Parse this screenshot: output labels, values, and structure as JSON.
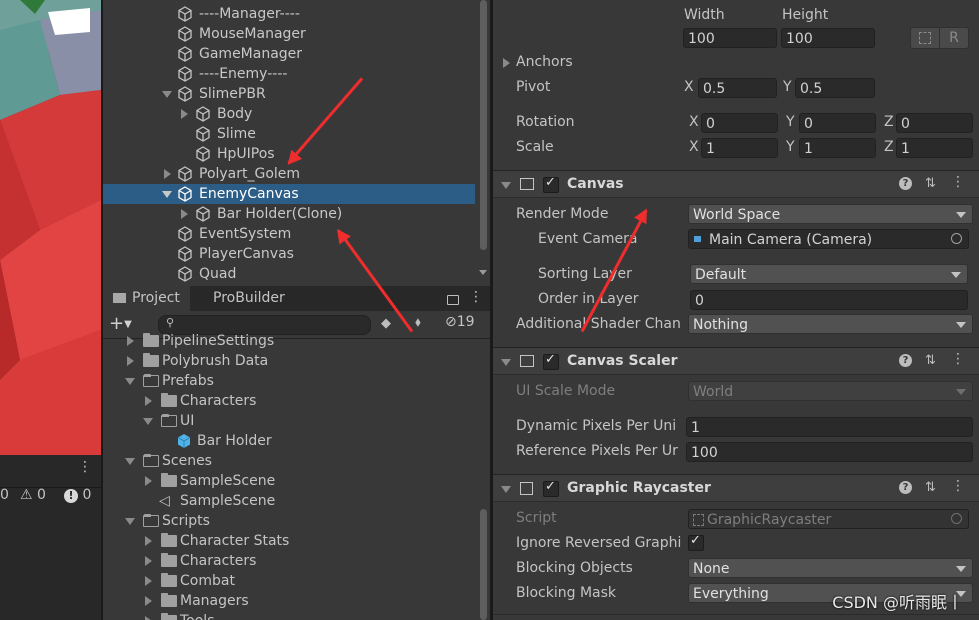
{
  "hierarchy": {
    "items": [
      {
        "label": "----Manager----"
      },
      {
        "label": "MouseManager"
      },
      {
        "label": "GameManager"
      },
      {
        "label": "----Enemy----"
      },
      {
        "label": "SlimePBR"
      },
      {
        "label": "Body"
      },
      {
        "label": "Slime"
      },
      {
        "label": "HpUIPos"
      },
      {
        "label": "Polyart_Golem"
      },
      {
        "label": "EnemyCanvas"
      },
      {
        "label": "Bar Holder(Clone)"
      },
      {
        "label": "EventSystem"
      },
      {
        "label": "PlayerCanvas"
      },
      {
        "label": "Quad"
      }
    ]
  },
  "console_counts": {
    "messages": "0",
    "warnings": "0",
    "errors": "0"
  },
  "project": {
    "tabs": [
      "Project",
      "ProBuilder"
    ],
    "search_placeholder": "",
    "hidden_count": "19",
    "items": [
      {
        "label": "PipelineSettings"
      },
      {
        "label": "Polybrush Data"
      },
      {
        "label": "Prefabs"
      },
      {
        "label": "Characters"
      },
      {
        "label": "UI"
      },
      {
        "label": "Bar Holder"
      },
      {
        "label": "Scenes"
      },
      {
        "label": "SampleScene"
      },
      {
        "label": "SampleScene"
      },
      {
        "label": "Scripts"
      },
      {
        "label": "Character Stats"
      },
      {
        "label": "Characters"
      },
      {
        "label": "Combat"
      },
      {
        "label": "Managers"
      },
      {
        "label": "Tools"
      }
    ]
  },
  "inspector": {
    "rect": {
      "width_label": "Width",
      "height_label": "Height",
      "width": "100",
      "height": "100",
      "r_button": "R",
      "anchors": "Anchors",
      "pivot": "Pivot",
      "pivot_x": "0.5",
      "pivot_y": "0.5",
      "rotation": "Rotation",
      "rot_x": "0",
      "rot_y": "0",
      "rot_z": "0",
      "scale": "Scale",
      "scale_x": "1",
      "scale_y": "1",
      "scale_z": "1",
      "x": "X",
      "y": "Y",
      "z": "Z"
    },
    "canvas": {
      "title": "Canvas",
      "render_mode_label": "Render Mode",
      "render_mode": "World Space",
      "event_camera_label": "Event Camera",
      "event_camera": "Main Camera (Camera)",
      "sorting_layer_label": "Sorting Layer",
      "sorting_layer": "Default",
      "order_label": "Order in Layer",
      "order": "0",
      "shader_label": "Additional Shader Chan",
      "shader": "Nothing"
    },
    "scaler": {
      "title": "Canvas Scaler",
      "ui_scale_label": "UI Scale Mode",
      "ui_scale": "World",
      "dyn_label": "Dynamic Pixels Per Uni",
      "dyn": "1",
      "ref_label": "Reference Pixels Per Ur",
      "ref": "100"
    },
    "raycaster": {
      "title": "Graphic Raycaster",
      "script_label": "Script",
      "script": "GraphicRaycaster",
      "ignore_label": "Ignore Reversed Graphi",
      "blocking_objects_label": "Blocking Objects",
      "blocking_objects": "None",
      "blocking_mask_label": "Blocking Mask",
      "blocking_mask": "Everything"
    }
  },
  "watermark": "CSDN @听雨眠丨",
  "colors": {
    "selection": "#2c5d87",
    "arrow": "#ef2d2d",
    "panel": "#383838"
  }
}
